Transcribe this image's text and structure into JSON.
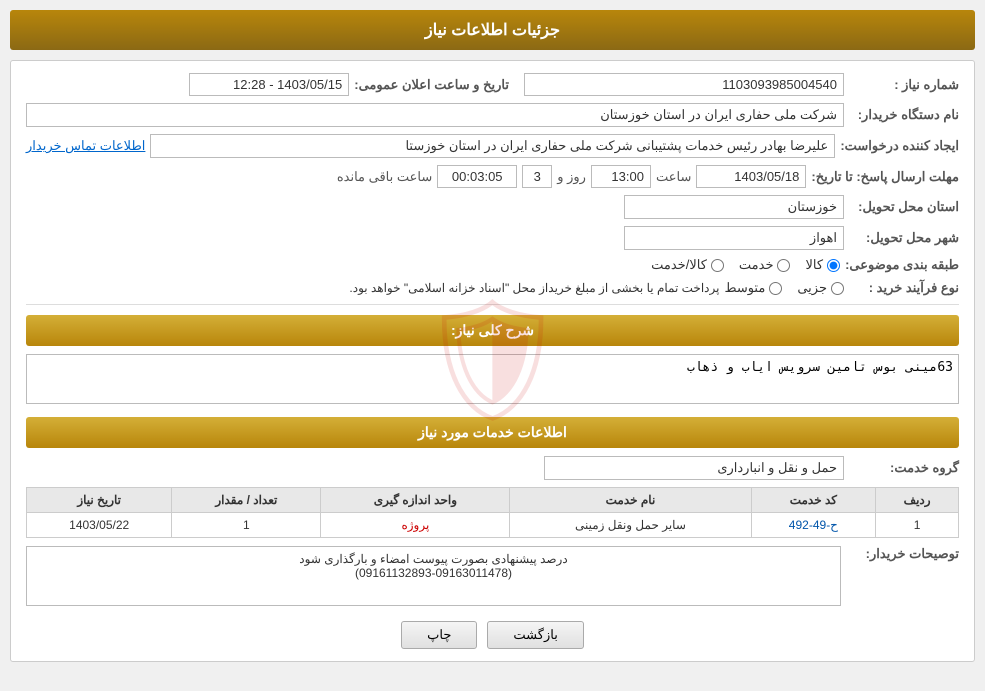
{
  "header": {
    "title": "جزئیات اطلاعات نیاز"
  },
  "fields": {
    "need_number_label": "شماره نیاز :",
    "need_number_value": "1103093985004540",
    "buyer_org_label": "نام دستگاه خریدار:",
    "buyer_org_value": "شرکت ملی حفاری ایران در استان خوزستان",
    "creator_label": "ایجاد کننده درخواست:",
    "creator_value": "علیرضا بهادر رئیس خدمات پشتیبانی شرکت ملی حفاری ایران در استان خوزستا",
    "creator_link": "اطلاعات تماس خریدار",
    "send_deadline_label": "مهلت ارسال پاسخ: تا تاریخ:",
    "date_value": "1403/05/18",
    "time_value": "13:00",
    "days_value": "3",
    "remaining_label": "روز و",
    "remaining_time": "00:03:05",
    "remaining_suffix": "ساعت باقی مانده",
    "announce_label": "تاریخ و ساعت اعلان عمومی:",
    "announce_value": "1403/05/15 - 12:28",
    "province_label": "استان محل تحویل:",
    "province_value": "خوزستان",
    "city_label": "شهر محل تحویل:",
    "city_value": "اهواز",
    "category_label": "طبقه بندی موضوعی:",
    "category_options": [
      "کالا",
      "خدمت",
      "کالا/خدمت"
    ],
    "category_selected": "کالا",
    "purchase_type_label": "نوع فرآیند خرید :",
    "purchase_types": [
      "جزیی",
      "متوسط"
    ],
    "purchase_note": "پرداخت تمام یا بخشی از مبلغ خریداز محل \"اسناد خزانه اسلامی\" خواهد بود.",
    "need_description_label": "شرح کلی نیاز:",
    "need_description_value": "63مینی بوس تامین سرویس ایاب و ذهاب",
    "services_section_title": "اطلاعات خدمات مورد نیاز",
    "service_group_label": "گروه خدمت:",
    "service_group_value": "حمل و نقل و انبارداری",
    "table": {
      "headers": [
        "ردیف",
        "کد خدمت",
        "نام خدمت",
        "واحد اندازه گیری",
        "تعداد / مقدار",
        "تاریخ نیاز"
      ],
      "rows": [
        {
          "index": "1",
          "code": "ح-49-492",
          "name": "سایر حمل ونقل زمینی",
          "unit": "پروژه",
          "quantity": "1",
          "date": "1403/05/22"
        }
      ]
    },
    "buyer_notes_label": "توصیحات خریدار:",
    "buyer_notes_value": "درصد پیشنهادی بصورت پیوست امضاء و بارگذاری شود\n(09161132893-09163011478)"
  },
  "buttons": {
    "print": "چاپ",
    "back": "بازگشت"
  }
}
